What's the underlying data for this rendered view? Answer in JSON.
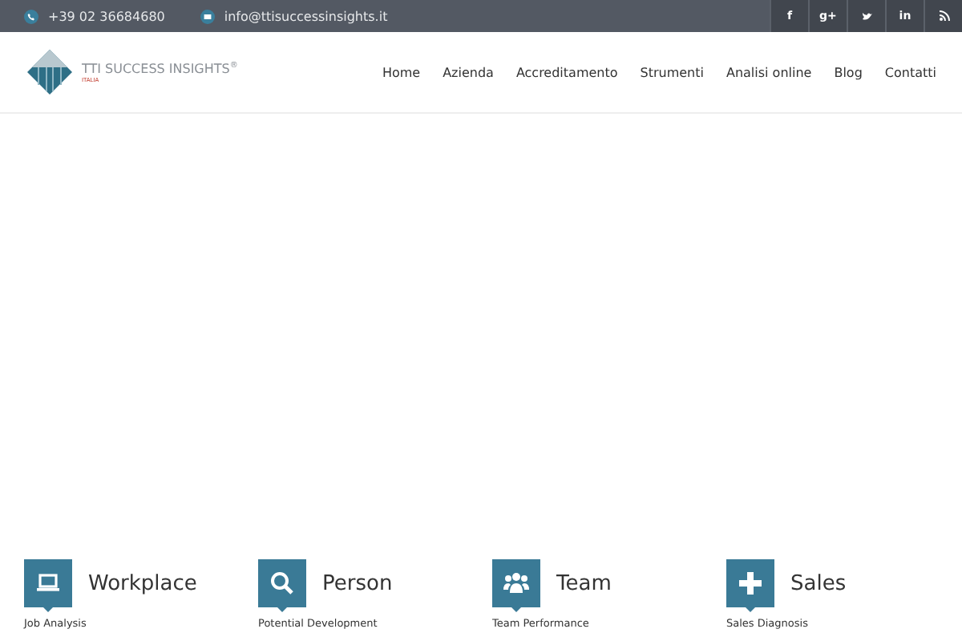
{
  "topbar": {
    "phone": "+39 02 36684680",
    "email": "info@ttisuccessinsights.it",
    "social": [
      {
        "kind": "facebook",
        "label": "f"
      },
      {
        "kind": "googleplus",
        "label": "g+"
      },
      {
        "kind": "twitter"
      },
      {
        "kind": "linkedin",
        "label": "in"
      },
      {
        "kind": "rss"
      }
    ]
  },
  "logo": {
    "name": "TTI SUCCESS INSIGHTS",
    "mark": "®",
    "sub": "ITALIA"
  },
  "nav": [
    {
      "label": "Home"
    },
    {
      "label": "Azienda"
    },
    {
      "label": "Accreditamento"
    },
    {
      "label": "Strumenti"
    },
    {
      "label": "Analisi online"
    },
    {
      "label": "Blog"
    },
    {
      "label": "Contatti"
    }
  ],
  "features": [
    {
      "kind": "laptop",
      "title": "Workplace",
      "link": "Job Analysis"
    },
    {
      "kind": "search",
      "title": "Person",
      "link": "Potential Development"
    },
    {
      "kind": "group",
      "title": "Team",
      "link": "Team Performance"
    },
    {
      "kind": "plus",
      "title": "Sales",
      "link": "Sales Diagnosis"
    }
  ]
}
